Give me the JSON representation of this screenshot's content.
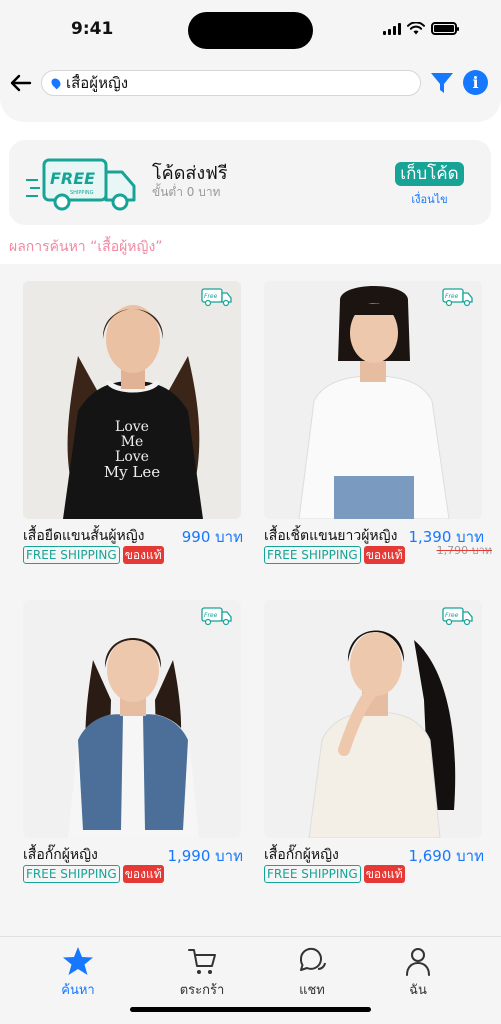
{
  "status_bar": {
    "time": "9:41"
  },
  "search": {
    "value": "เสื้อผู้หญิง"
  },
  "icons": {
    "back": "arrow-left-icon",
    "filter": "funnel-icon",
    "info": "info-icon",
    "search": "location-pin-icon"
  },
  "coupon": {
    "badge_text": "FREE",
    "badge_sub": "SHIPPING",
    "title": "โค้ดส่งฟรี",
    "subtitle": "ขั้นต่ำ 0 บาท",
    "collect_label": "เก็บโค้ด",
    "conditions_label": "เงื่อนไข"
  },
  "results": {
    "label": "ผลการค้นหา “เสื้อผู้หญิง”"
  },
  "colors": {
    "accent": "#1677ff",
    "teal": "#17a497",
    "red": "#e53935",
    "pink": "#f08aa3"
  },
  "ship_icon": {
    "label": "Free"
  },
  "products": [
    {
      "name": "เสื้อยืดแขนสั้นผู้หญิง",
      "price": "990 บาท",
      "old_price": "",
      "tag_shipping": "FREE SHIPPING",
      "tag_authentic": "ของแท้",
      "shirt_text": [
        "Love",
        "Me",
        "Love",
        "My Lee"
      ]
    },
    {
      "name": "เสื้อเชิ้ตแขนยาวผู้หญิง",
      "price": "1,390 บาท",
      "old_price": "1,790 บาท",
      "tag_shipping": "FREE SHIPPING",
      "tag_authentic": "ของแท้"
    },
    {
      "name": "เสื้อกั๊กผู้หญิง",
      "price": "1,990 บาท",
      "old_price": "",
      "tag_shipping": "FREE SHIPPING",
      "tag_authentic": "ของแท้"
    },
    {
      "name": "เสื้อกั๊กผู้หญิง",
      "price": "1,690 บาท",
      "old_price": "",
      "tag_shipping": "FREE SHIPPING",
      "tag_authentic": "ของแท้"
    }
  ],
  "tabbar": {
    "items": [
      {
        "label": "ค้นหา",
        "icon": "star-icon",
        "active": true
      },
      {
        "label": "ตระกร้า",
        "icon": "cart-icon",
        "active": false
      },
      {
        "label": "แชท",
        "icon": "chat-icon",
        "active": false
      },
      {
        "label": "ฉัน",
        "icon": "user-icon",
        "active": false
      }
    ]
  }
}
